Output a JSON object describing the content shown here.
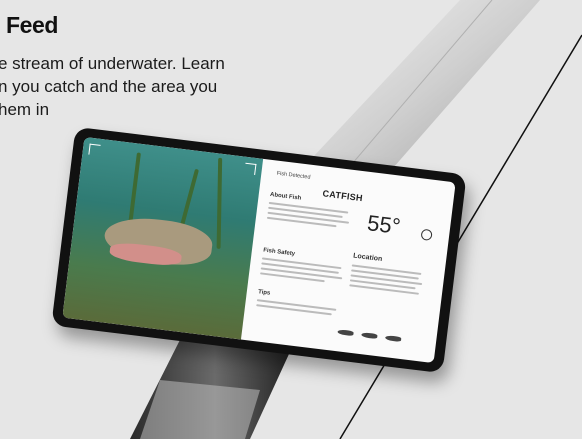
{
  "hero": {
    "title": "l Feed",
    "desc_line1": "e stream of underwater. Learn",
    "desc_line2": "n you catch and the area you",
    "desc_line3": "hem in"
  },
  "device": {
    "label_detected": "Fish Detected",
    "fish_name": "CATFISH",
    "temperature": "55°",
    "weather_icon": "sun-icon",
    "sections": {
      "about": "About Fish",
      "safety": "Fish Safety",
      "tips": "Tips",
      "location": "Location"
    }
  },
  "colors": {
    "background": "#e6e6e6",
    "pole": "#d9d9d9",
    "device_frame": "#111111",
    "screen": "#fbfbfb",
    "water": "#3f8f8a"
  }
}
